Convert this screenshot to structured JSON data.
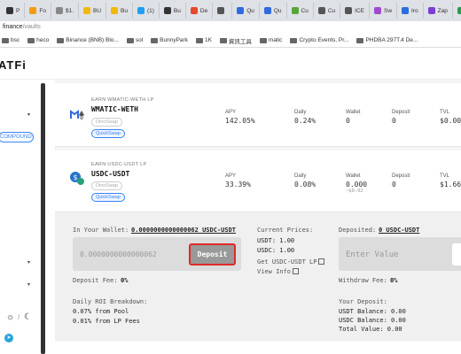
{
  "browser": {
    "tabs": [
      {
        "label": "P",
        "color": "#333"
      },
      {
        "label": "Fo",
        "color": "#f39c12"
      },
      {
        "label": "$1.",
        "color": "#888"
      },
      {
        "label": "BU",
        "color": "#f0b90b"
      },
      {
        "label": "Bu",
        "color": "#f0b90b"
      },
      {
        "label": "(1)",
        "color": "#1da1f2"
      },
      {
        "label": "Bu",
        "color": "#333"
      },
      {
        "label": "De",
        "color": "#e8472a"
      },
      {
        "label": "",
        "color": "#555"
      },
      {
        "label": "Qu",
        "color": "#2d6cdf"
      },
      {
        "label": "Qu",
        "color": "#2d6cdf"
      },
      {
        "label": "Cu",
        "color": "#57a639"
      },
      {
        "label": "Cu",
        "color": "#555"
      },
      {
        "label": "ICE",
        "color": "#555"
      },
      {
        "label": "Sw",
        "color": "#a14bd1"
      },
      {
        "label": "Iro",
        "color": "#2d6cdf"
      },
      {
        "label": "Zap",
        "color": "#7d3fd1"
      },
      {
        "label": "强",
        "color": "#2d9c4a"
      }
    ],
    "url_host": "finance",
    "url_path": "/vaults",
    "bookmarks": [
      "bsc",
      "heco",
      "Binance (BNB) Blo...",
      "sol",
      "BunnyPark",
      "1K",
      "資訊工具",
      "matic",
      "Crypto Events, Pr...",
      "PHDBA 297T.4 De..."
    ]
  },
  "header": {
    "logo": "ATFi"
  },
  "sidebar": {
    "compound": "COMPOUND",
    "caret": "▾",
    "theme_sep": "/"
  },
  "vaults": [
    {
      "earn_label": "EARN WMATIC-WETH LP",
      "pair": "WMATIC-WETH",
      "dex_grey": "DinoSwap",
      "dex_blue": "QuickSwap",
      "apy_label": "APY",
      "apy": "142.05%",
      "daily_label": "Daily",
      "daily": "0.24%",
      "wallet_label": "Wallet",
      "wallet": "0",
      "deposit_label": "Deposit",
      "deposit": "0",
      "tvl_label": "TVL",
      "tvl": "$0.00",
      "icon_color": "#2d6cdf"
    },
    {
      "earn_label": "EARN USDC-USDT LP",
      "pair": "USDC-USDT",
      "dex_grey": "DinoSwap",
      "dex_blue": "QuickSwap",
      "apy_label": "APY",
      "apy": "33.39%",
      "daily_label": "Daily",
      "daily": "0.08%",
      "wallet_label": "Wallet",
      "wallet": "0.000",
      "wallet_sub": "~$0.02",
      "deposit_label": "Deposit",
      "deposit": "0",
      "tvl_label": "TVL",
      "tvl": "$1.66",
      "icon_color": "#2775ca"
    }
  ],
  "detail": {
    "in_wallet_label": "In Your Wallet:",
    "in_wallet_value": "0.0000000000000062 USDC-USDT",
    "wallet_input_value": "0.0000000000000062",
    "deposit_button": "Deposit",
    "deposit_fee_label": "Deposit Fee:",
    "deposit_fee_value": "0%",
    "current_prices_label": "Current Prices:",
    "price_usdt": "USDT: 1.00",
    "price_usdc": "USDC: 1.00",
    "get_lp": "Get USDC-USDT LP",
    "view_info": "View Info",
    "deposited_label": "Deposited:",
    "deposited_value": "0 USDC-USDT",
    "withdraw_placeholder": "Enter Value",
    "withdraw_fee_label": "Withdraw Fee:",
    "withdraw_fee_value": "0%",
    "roi_label": "Daily ROI Breakdown:",
    "roi_pool": "0.07% from Pool",
    "roi_lp": "0.01% from LP Fees",
    "your_deposit_label": "Your Deposit:",
    "usdt_balance": "USDT Balance: 0.00",
    "usdc_balance": "USDC Balance: 0.00",
    "total_value": "Total Value: 0.00"
  }
}
